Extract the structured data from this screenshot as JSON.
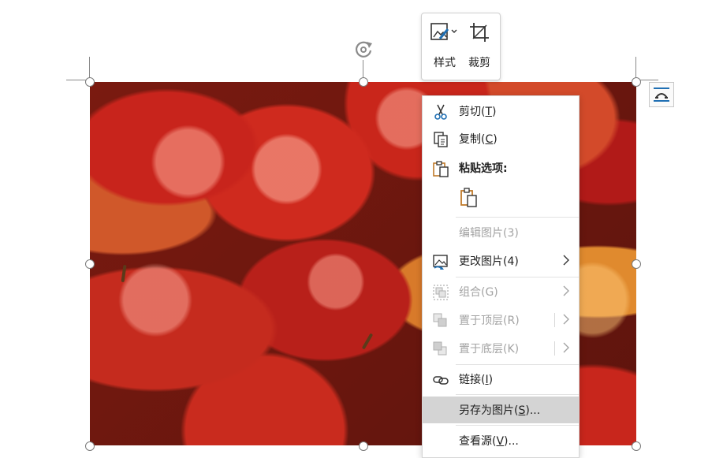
{
  "mini_toolbar": {
    "style_label": "样式",
    "crop_label": "裁剪"
  },
  "context_menu": {
    "items": [
      {
        "label": "剪切(",
        "key": "T",
        "tail": ")"
      },
      {
        "label": "复制(",
        "key": "C",
        "tail": ")"
      },
      {
        "label": "粘贴选项:"
      },
      {
        "label": "编辑图片(3)"
      },
      {
        "label": "更改图片(4)"
      },
      {
        "label": "组合(G)"
      },
      {
        "label": "置于顶层(R)"
      },
      {
        "label": "置于底层(K)"
      },
      {
        "label": "链接(",
        "key": "I",
        "tail": ")"
      },
      {
        "label": "另存为图片(",
        "key": "S",
        "tail": ")..."
      },
      {
        "label": "查看源(",
        "key": "V",
        "tail": ")..."
      }
    ]
  },
  "colors": {
    "highlight": "#d4d4d4",
    "disabled_text": "#a3a3a3",
    "paste_icon": "#c07a2a"
  },
  "icons": [
    "rotate-icon",
    "picture-style-icon",
    "crop-icon",
    "layout-options-icon",
    "scissors-icon",
    "copy-icon",
    "clipboard-icon",
    "paste-keep-icon",
    "change-picture-icon",
    "group-icon",
    "bring-front-icon",
    "send-back-icon",
    "link-icon",
    "chevron-right-icon"
  ]
}
